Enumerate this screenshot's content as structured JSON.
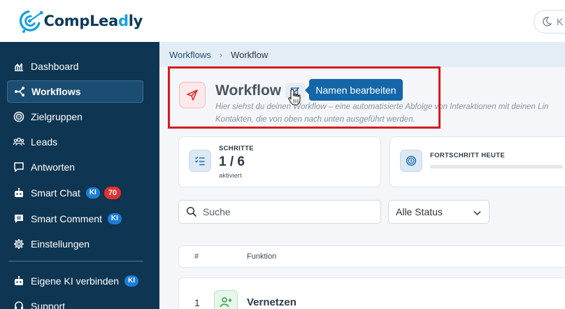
{
  "app": {
    "logo_part1": "CompLea",
    "logo_part2": "d",
    "logo_part3": "ly",
    "theme_toggle_text": "K",
    "brand_color": "#0d3a5a",
    "accent_color": "#1aa0dc"
  },
  "sidebar": {
    "items": [
      {
        "label": "Dashboard",
        "icon": "chart-icon"
      },
      {
        "label": "Workflows",
        "icon": "workflow-icon",
        "active": true
      },
      {
        "label": "Zielgruppen",
        "icon": "target-icon"
      },
      {
        "label": "Leads",
        "icon": "users-icon"
      },
      {
        "label": "Antworten",
        "icon": "chat-icon"
      },
      {
        "label": "Smart Chat",
        "icon": "robot-icon",
        "badge_ki": "KI",
        "badge_count": "70"
      },
      {
        "label": "Smart Comment",
        "icon": "comment-icon",
        "badge_ki": "KI"
      },
      {
        "label": "Einstellungen",
        "icon": "gear-icon"
      },
      {
        "label": "Eigene KI verbinden",
        "icon": "robot-icon",
        "badge_ki": "KI"
      },
      {
        "label": "Support",
        "icon": "support-icon"
      }
    ]
  },
  "breadcrumb": {
    "parent": "Workflows",
    "current": "Workflow"
  },
  "page": {
    "title": "Workflow",
    "tooltip": "Namen bearbeiten",
    "subtitle_line1": "Hier siehst du deinen Workflow – eine automatisierte Abfolge von Interaktionen mit deinen Lin",
    "subtitle_line2": "Kontakten, die von oben nach unten ausgeführt werden."
  },
  "stats": {
    "steps_label": "SCHRITTE",
    "steps_value": "1 / 6",
    "steps_sub": "aktiviert",
    "progress_label": "FORTSCHRITT HEUTE",
    "progress_fraction": 0
  },
  "filters": {
    "search_placeholder": "Suche",
    "status_selected": "Alle Status"
  },
  "table": {
    "col_num": "#",
    "col_func": "Funktion",
    "rows": [
      {
        "num": "1",
        "name": "Vernetzen",
        "icon": "add-user-icon"
      }
    ]
  }
}
